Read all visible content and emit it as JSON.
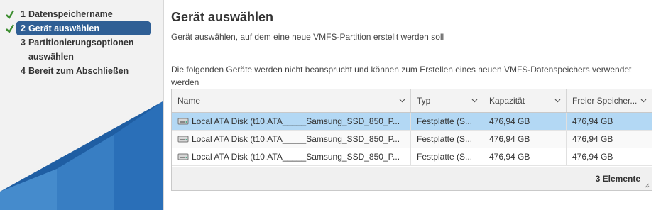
{
  "steps": [
    {
      "num": "1",
      "label": "Datenspeichername",
      "done": true
    },
    {
      "num": "2",
      "label": "Gerät auswählen",
      "done": true,
      "active": true
    },
    {
      "num": "3",
      "label_line1": "Partitionierungsoptionen",
      "label_line2": "auswählen"
    },
    {
      "num": "4",
      "label": "Bereit zum Abschließen"
    }
  ],
  "page": {
    "title": "Gerät auswählen",
    "subtitle": "Gerät auswählen, auf dem eine neue VMFS-Partition erstellt werden soll",
    "description": "Die folgenden Geräte werden nicht beansprucht und können zum Erstellen eines neuen VMFS-Datenspeichers verwendet werden"
  },
  "table": {
    "columns": [
      "Name",
      "Typ",
      "Kapazität",
      "Freier Speicher..."
    ],
    "rows": [
      {
        "name": "Local ATA Disk (t10.ATA_____Samsung_SSD_850_P...",
        "type": "Festplatte (S...",
        "capacity": "476,94 GB",
        "free": "476,94 GB",
        "selected": true
      },
      {
        "name": "Local ATA Disk (t10.ATA_____Samsung_SSD_850_P...",
        "type": "Festplatte (S...",
        "capacity": "476,94 GB",
        "free": "476,94 GB"
      },
      {
        "name": "Local ATA Disk (t10.ATA_____Samsung_SSD_850_P...",
        "type": "Festplatte (S...",
        "capacity": "476,94 GB",
        "free": "476,94 GB"
      }
    ],
    "count_label": "3 Elemente"
  },
  "colors": {
    "active_step": "#2f5f95",
    "check": "#3c8d2f",
    "selected_row": "#b3d8f4",
    "deco_dark": "#1f5ea3",
    "deco_light": "#3b82c6"
  },
  "icons": {
    "done": "check-icon",
    "disk": "disk-icon",
    "sort": "chevron-down-icon"
  }
}
